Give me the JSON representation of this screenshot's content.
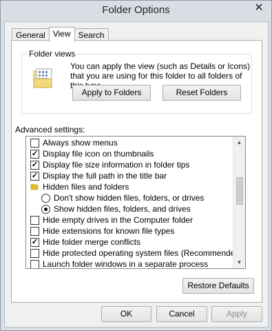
{
  "window": {
    "title": "Folder Options"
  },
  "tabs": [
    {
      "label": "General"
    },
    {
      "label": "View"
    },
    {
      "label": "Search"
    }
  ],
  "folder_views": {
    "label": "Folder views",
    "description": "You can apply the view (such as Details or Icons) that you are using for this folder to all folders of this type.",
    "apply_button": "Apply to Folders",
    "reset_button": "Reset Folders"
  },
  "advanced": {
    "label": "Advanced settings:",
    "items": [
      {
        "type": "checkbox",
        "label": "Always show menus",
        "checked": false
      },
      {
        "type": "checkbox",
        "label": "Display file icon on thumbnails",
        "checked": true
      },
      {
        "type": "checkbox",
        "label": "Display file size information in folder tips",
        "checked": true
      },
      {
        "type": "checkbox",
        "label": "Display the full path in the title bar",
        "checked": true
      },
      {
        "type": "folder",
        "label": "Hidden files and folders"
      },
      {
        "type": "radio",
        "label": "Don't show hidden files, folders, or drives",
        "checked": false
      },
      {
        "type": "radio",
        "label": "Show hidden files, folders, and drives",
        "checked": true
      },
      {
        "type": "checkbox",
        "label": "Hide empty drives in the Computer folder",
        "checked": false
      },
      {
        "type": "checkbox",
        "label": "Hide extensions for known file types",
        "checked": false
      },
      {
        "type": "checkbox",
        "label": "Hide folder merge conflicts",
        "checked": true
      },
      {
        "type": "checkbox",
        "label": "Hide protected operating system files (Recommended)",
        "checked": false
      },
      {
        "type": "checkbox",
        "label": "Launch folder windows in a separate process",
        "checked": false
      }
    ],
    "restore_button": "Restore Defaults"
  },
  "footer": {
    "ok": "OK",
    "cancel": "Cancel",
    "apply": "Apply"
  },
  "colors": {
    "accent": "#e5b82f",
    "window_frame": "#d9dee4"
  }
}
